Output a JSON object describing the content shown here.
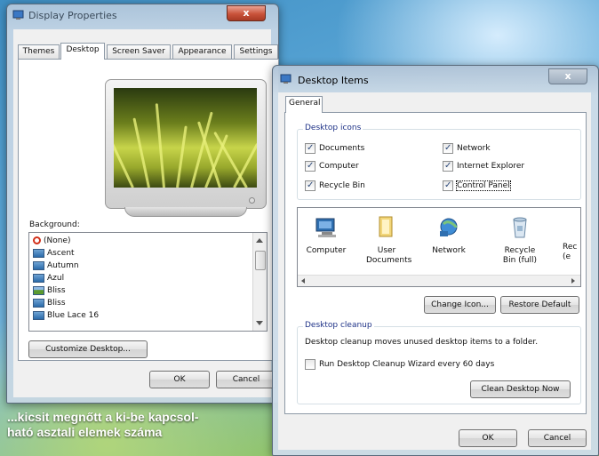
{
  "display_properties": {
    "title": "Display Properties",
    "close_label": "x",
    "tabs": [
      "Themes",
      "Desktop",
      "Screen Saver",
      "Appearance",
      "Settings"
    ],
    "background_label": "Background:",
    "backgrounds": [
      "(None)",
      "Ascent",
      "Autumn",
      "Azul",
      "Bliss",
      "Bliss",
      "Blue Lace 16"
    ],
    "customize_button": "Customize Desktop...",
    "ok_button": "OK",
    "cancel_button": "Cancel"
  },
  "desktop_items": {
    "title": "Desktop Items",
    "close_label": "x",
    "tab": "General",
    "icons_group_title": "Desktop icons",
    "checkboxes": [
      {
        "label": "Documents",
        "checked": true
      },
      {
        "label": "Network",
        "checked": true
      },
      {
        "label": "Computer",
        "checked": true
      },
      {
        "label": "Internet Explorer",
        "checked": true
      },
      {
        "label": "Recycle Bin",
        "checked": true
      },
      {
        "label": "Control Panel",
        "checked": true
      }
    ],
    "icon_list": [
      "Computer",
      "User Documents",
      "Network",
      "Recycle Bin (full)",
      "Rec (e"
    ],
    "change_icon_button": "Change Icon...",
    "restore_default_button": "Restore Default",
    "cleanup_group_title": "Desktop cleanup",
    "cleanup_text": "Desktop cleanup moves unused desktop items to a folder.",
    "cleanup_checkbox": "Run Desktop Cleanup Wizard every 60 days",
    "cleanup_checkbox_checked": false,
    "clean_now_button": "Clean Desktop Now",
    "ok_button": "OK",
    "cancel_button": "Cancel"
  },
  "caption": {
    "line1": "...kicsit megnőtt a ki-be kapcsol-",
    "line2": "ható asztali elemek száma"
  }
}
